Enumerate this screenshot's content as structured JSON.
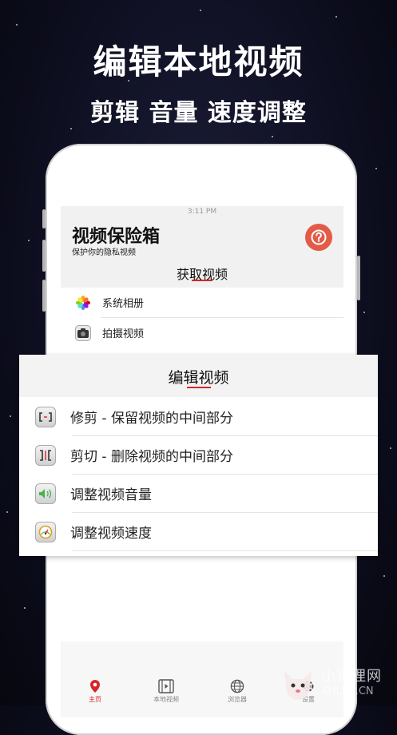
{
  "promo": {
    "title": "编辑本地视频",
    "subtitle": "剪辑 音量 速度调整"
  },
  "statusbar": {
    "time": "3:11 PM"
  },
  "app": {
    "title": "视频保险箱",
    "subtitle": "保护你的隐私视频",
    "help_icon": "question-icon",
    "accent": "#d7262b"
  },
  "get_video": {
    "title": "获取视频",
    "items": [
      {
        "label": "系统相册",
        "icon": "photos-icon"
      },
      {
        "label": "拍摄视频",
        "icon": "camera-icon"
      }
    ]
  },
  "edit_video": {
    "title": "编辑视频",
    "items": [
      {
        "label": "修剪 - 保留视频的中间部分",
        "icon": "trim-icon"
      },
      {
        "label": "剪切 - 删除视频的中间部分",
        "icon": "cut-icon"
      },
      {
        "label": "调整视频音量",
        "icon": "speaker-icon"
      },
      {
        "label": "调整视频速度",
        "icon": "speedometer-icon"
      }
    ]
  },
  "tabbar": [
    {
      "label": "主页",
      "icon": "location-pin-icon",
      "active": true
    },
    {
      "label": "本地视频",
      "icon": "film-icon",
      "active": false
    },
    {
      "label": "浏览器",
      "icon": "globe-icon",
      "active": false
    },
    {
      "label": "设置",
      "icon": "gear-icon",
      "active": false
    }
  ],
  "watermark": {
    "text1": "小狐狸网",
    "text2": "XHLKS.CN"
  }
}
